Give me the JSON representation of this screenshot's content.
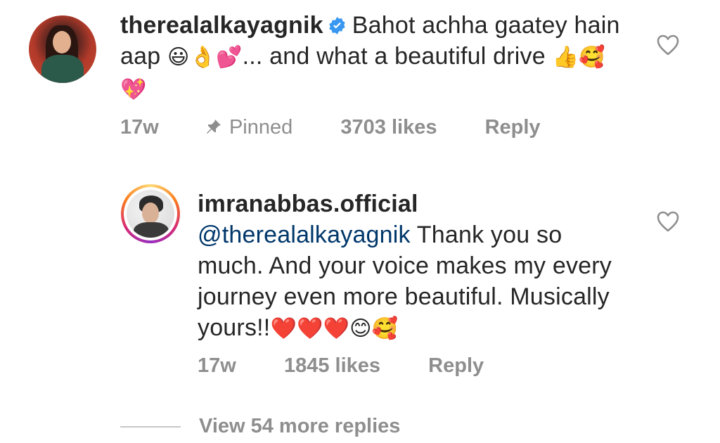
{
  "comments": [
    {
      "username": "therealalkayagnik",
      "verified": true,
      "text_part1": "Bahot achha gaatey hain aap",
      "emojis1": "😃👌💕",
      "text_part2": "... and what a beautiful drive",
      "emojis2": "👍🥰💖",
      "time": "17w",
      "pinned_label": "Pinned",
      "likes": "3703 likes",
      "reply_label": "Reply"
    },
    {
      "username": "imranabbas.official",
      "mention": "@therealalkayagnik",
      "text": "Thank you so much. And your voice makes my every journey even more beautiful. Musically yours!!",
      "emojis": "❤️❤️❤️😊🥰",
      "time": "17w",
      "likes": "1845 likes",
      "reply_label": "Reply",
      "view_replies": "View 54 more replies"
    }
  ],
  "colors": {
    "text": "#262626",
    "meta": "#8e8e8e",
    "mention": "#00376b",
    "verified": "#3897f0"
  },
  "icons": [
    "verified-badge-icon",
    "pin-icon",
    "heart-outline-icon"
  ]
}
